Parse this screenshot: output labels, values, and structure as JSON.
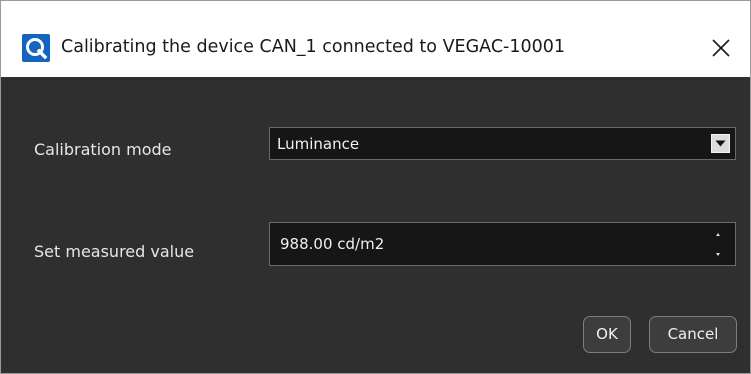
{
  "window": {
    "title": "Calibrating the device CAN_1 connected to VEGAC-10001",
    "app_icon": "app-logo-icon",
    "close_icon": "close-icon"
  },
  "form": {
    "mode_label": "Calibration mode",
    "mode_value": "Luminance",
    "mode_arrow_icon": "chevron-down-icon",
    "measured_label": "Set measured value",
    "measured_value": "988.00 cd/m2",
    "stepper_up_icon": "caret-up-icon",
    "stepper_down_icon": "caret-down-icon"
  },
  "actions": {
    "ok_label": "OK",
    "cancel_label": "Cancel"
  },
  "colors": {
    "background": "#2f2f2f",
    "field_background": "#161616",
    "titlebar": "#ffffff",
    "accent": "#1565c0",
    "text": "#e6e6e6"
  }
}
